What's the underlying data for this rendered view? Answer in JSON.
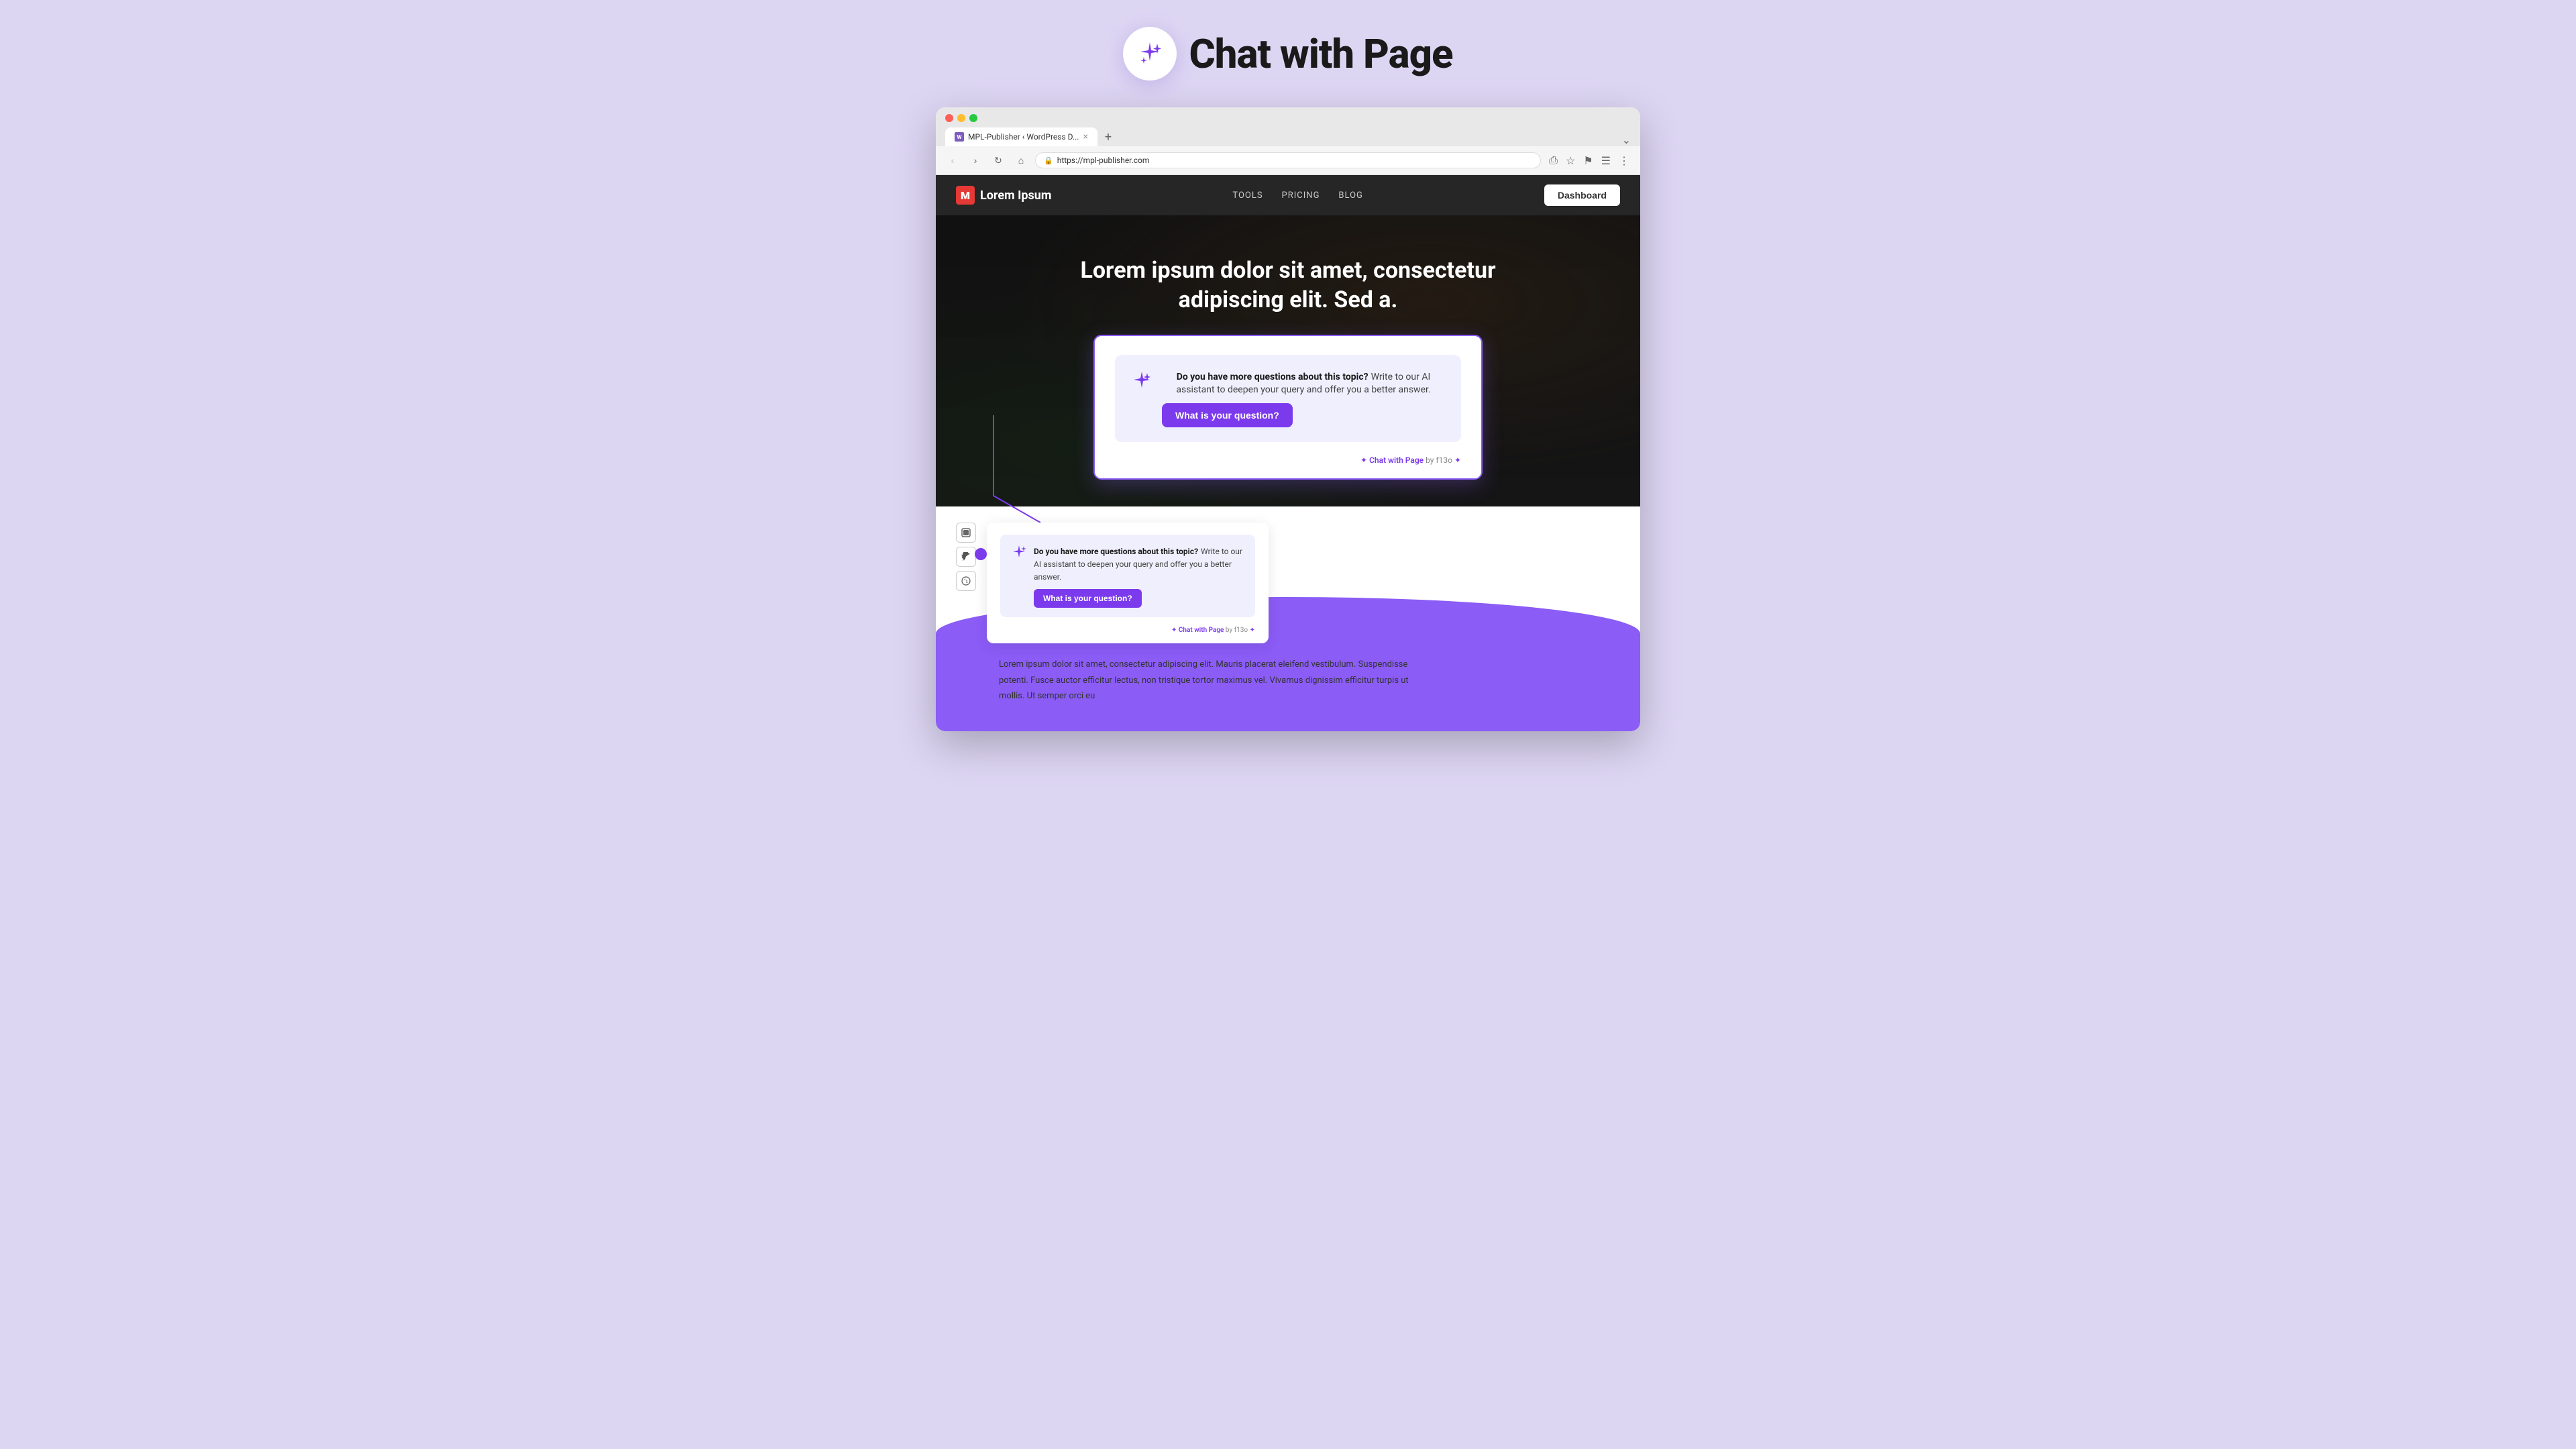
{
  "header": {
    "title": "Chat with Page",
    "icon_label": "sparkles-icon"
  },
  "browser": {
    "tab_label": "MPL-Publisher ‹ WordPress D...",
    "tab_favicon": "M",
    "address": "https://mpl-publisher.com",
    "traffic_lights": [
      "red",
      "yellow",
      "green"
    ],
    "new_tab_label": "+",
    "nav_buttons": [
      "←",
      "→",
      "↺",
      "⌂"
    ],
    "toolbar_actions": [
      "⎙",
      "☆",
      "⚑",
      "≡",
      "⋮"
    ]
  },
  "site": {
    "logo_icon": "M",
    "logo_text": "Lorem Ipsum",
    "nav_links": [
      "TOOLS",
      "PRICING",
      "BLOG"
    ],
    "dashboard_btn": "Dashboard",
    "hero_title_line1": "Lorem ipsum dolor sit amet, consectetur",
    "hero_title_line2": "adipiscing elit. Sed a."
  },
  "featured_widget": {
    "question_bold": "Do you have more questions about this topic?",
    "question_rest": " Write to our AI assistant to deepen your query and offer you a better answer.",
    "button_label": "What is your question?",
    "footer_sparkle_left": "✦",
    "footer_brand": "Chat with Page",
    "footer_by": " by f13o ",
    "footer_sparkle_right": "✦"
  },
  "small_widget": {
    "question_bold": "Do you have more questions about this topic?",
    "question_rest": " Write to our AI assistant to deepen your query and offer you a better answer.",
    "button_label": "What is your question?",
    "footer_sparkle_left": "✦",
    "footer_brand": "Chat with Page",
    "footer_by": " by f13o ",
    "footer_sparkle_right": "✦"
  },
  "share_buttons": [
    {
      "icon": "⊞",
      "label": "save-share-btn"
    },
    {
      "icon": "🐦",
      "label": "twitter-share-btn"
    },
    {
      "icon": "📱",
      "label": "whatsapp-share-btn"
    }
  ],
  "article_text": "Lorem ipsum dolor sit amet, consectetur adipiscing elit. Mauris placerat eleifend vestibulum. Suspendisse potenti. Fusce auctor efficitur lectus, non tristique tortor maximus vel. Vivamus dignissim efficitur turpis ut mollis. Ut semper orci eu",
  "colors": {
    "purple_primary": "#7c3aed",
    "purple_light": "#8b5cf6",
    "purple_bg": "#ddd6f3",
    "widget_bg": "#f0effe"
  }
}
